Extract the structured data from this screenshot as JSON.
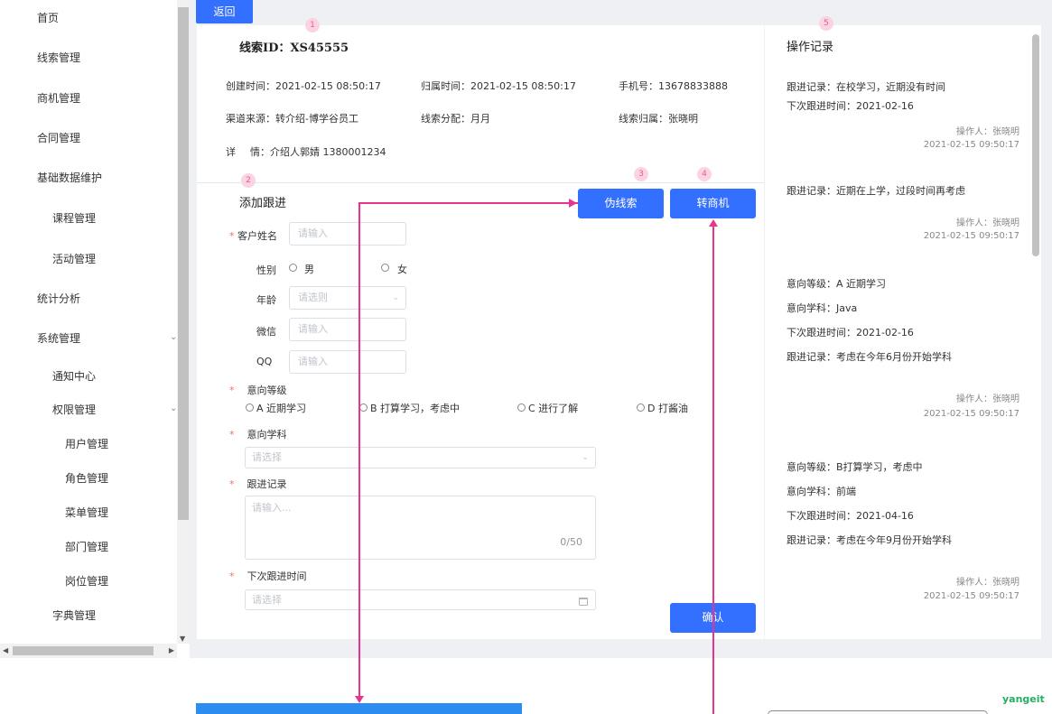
{
  "sidebar": {
    "items": [
      {
        "label": "首页",
        "indent": 0
      },
      {
        "label": "线索管理",
        "indent": 0
      },
      {
        "label": "商机管理",
        "indent": 0
      },
      {
        "label": "合同管理",
        "indent": 0
      },
      {
        "label": "基础数据维护",
        "indent": 0
      },
      {
        "label": "课程管理",
        "indent": 1
      },
      {
        "label": "活动管理",
        "indent": 1
      },
      {
        "label": "统计分析",
        "indent": 0
      },
      {
        "label": "系统管理",
        "indent": 0
      },
      {
        "label": "通知中心",
        "indent": 1
      },
      {
        "label": "权限管理",
        "indent": 1
      },
      {
        "label": "用户管理",
        "indent": 2
      },
      {
        "label": "角色管理",
        "indent": 2
      },
      {
        "label": "菜单管理",
        "indent": 2
      },
      {
        "label": "部门管理",
        "indent": 2
      },
      {
        "label": "岗位管理",
        "indent": 2
      },
      {
        "label": "字典管理",
        "indent": 1
      }
    ]
  },
  "header": {
    "back_label": "返回"
  },
  "clue": {
    "id_label": "线索ID：XS45555",
    "created": "创建时间：2021-02-15 08:50:17",
    "assigned_time": "归属时间：2021-02-15 08:50:17",
    "phone": "手机号：13678833888",
    "channel": "渠道来源：转介绍-博学谷员工",
    "distribution": "线索分配：月月",
    "owner": "线索归属：张晓明",
    "detail_label": "详",
    "detail_value": "情：介绍人郭婧 1380001234"
  },
  "followup": {
    "title": "添加跟进",
    "fake_clue_button": "伪线索",
    "to_opportunity_button": "转商机",
    "confirm_button": "确认",
    "name_label": "客户姓名",
    "name_placeholder": "请输入",
    "gender_label": "性别",
    "gender_male": "男",
    "gender_female": "女",
    "age_label": "年龄",
    "age_placeholder": "请选则",
    "wechat_label": "微信",
    "wechat_placeholder": "请输入",
    "qq_label": "QQ",
    "qq_placeholder": "请输入",
    "level_label": "意向等级",
    "level_options": [
      "A 近期学习",
      "B 打算学习，考虑中",
      "C 进行了解",
      "D 打酱油"
    ],
    "subject_label": "意向学科",
    "subject_placeholder": "请选择",
    "record_label": "跟进记录",
    "record_placeholder": "请输入...",
    "record_counter": "0/50",
    "next_time_label": "下次跟进时间",
    "next_time_placeholder": "请选择"
  },
  "records": {
    "title": "操作记录",
    "entries": [
      {
        "lines": [
          "跟进记录：在校学习，近期没有时间",
          "下次跟进时间：2021-02-16"
        ],
        "operator": "操作人：张晓明",
        "time": "2021-02-15 09:50:17"
      },
      {
        "lines": [
          "跟进记录：近期在上学，过段时间再考虑"
        ],
        "operator": "操作人：张晓明",
        "time": "2021-02-15 09:50:17"
      },
      {
        "lines": [
          "意向等级：A 近期学习",
          "意向学科：Java",
          "下次跟进时间：2021-02-16",
          "跟进记录：考虑在今年6月份开始学科"
        ],
        "operator": "操作人：张晓明",
        "time": "2021-02-15 09:50:17"
      },
      {
        "lines": [
          "意向等级：B打算学习，考虑中",
          "意向学科：前端",
          "下次跟进时间：2021-04-16",
          "跟进记录：考虑在今年9月份开始学科"
        ],
        "operator": "操作人：张晓明",
        "time": "2021-02-15 09:50:17"
      }
    ]
  },
  "badges": [
    "1",
    "2",
    "3",
    "4",
    "5"
  ],
  "logo": "yangeit",
  "colors": {
    "primary": "#3370ff",
    "annotation": "#e8348a",
    "required": "#f56c6c"
  }
}
